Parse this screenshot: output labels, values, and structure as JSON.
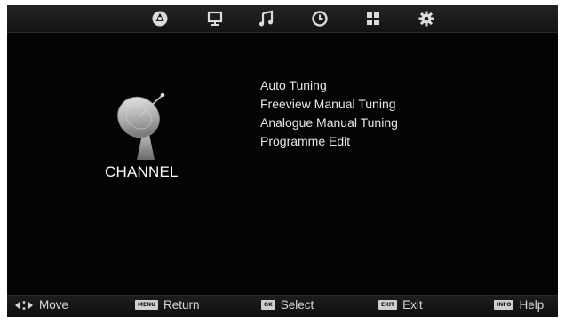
{
  "top_nav": [
    {
      "icon": "channel-icon"
    },
    {
      "icon": "picture-icon"
    },
    {
      "icon": "sound-icon"
    },
    {
      "icon": "time-icon"
    },
    {
      "icon": "lock-icon"
    },
    {
      "icon": "settings-icon"
    }
  ],
  "section": {
    "title": "CHANNEL",
    "icon": "satellite-dish-icon"
  },
  "menu": {
    "items": [
      "Auto Tuning",
      "Freeview Manual Tuning",
      "Analogue Manual Tuning",
      "Programme Edit"
    ]
  },
  "footer": {
    "move": {
      "icon": "left-right-arrows-icon",
      "label": "Move"
    },
    "return": {
      "key": "MENU",
      "label": "Return"
    },
    "select": {
      "key": "OK",
      "label": "Select"
    },
    "exit": {
      "key": "EXIT",
      "label": "Exit"
    },
    "help": {
      "key": "INFO",
      "label": "Help"
    }
  },
  "colors": {
    "background": "#040404",
    "text": "#e6e6e6",
    "icon": "#dcdcdc"
  }
}
